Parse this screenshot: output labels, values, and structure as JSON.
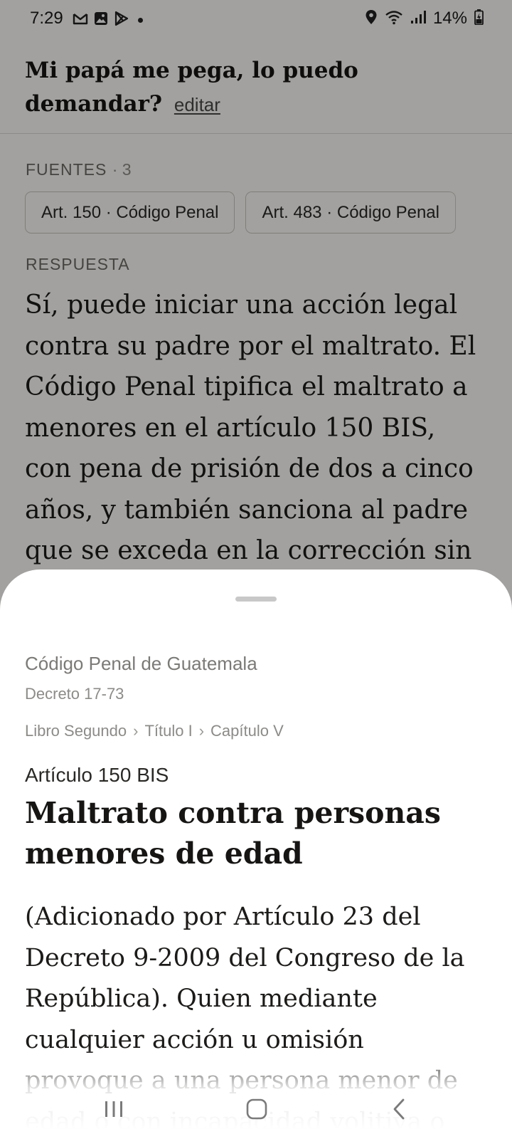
{
  "status_bar": {
    "time": "7:29",
    "battery": "14%",
    "left_icons": [
      "gmail-icon",
      "gallery-icon",
      "play-store-icon",
      "notification-dot"
    ],
    "right_icons": [
      "location-icon",
      "wifi-icon",
      "signal-icon",
      "battery-charging-icon"
    ]
  },
  "question": {
    "text": "Mi papá me pega, lo puedo demandar?",
    "edit_label": "editar"
  },
  "sources": {
    "label": "FUENTES",
    "count": "· 3",
    "chips": [
      {
        "label": "Art. 150 · Código Penal"
      },
      {
        "label": "Art. 483 · Código Penal"
      }
    ]
  },
  "answer": {
    "label": "RESPUESTA",
    "text": "Sí, puede iniciar una acción legal contra su padre por el maltrato. El Código Penal tipifica el maltrato a menores en el artículo 150 BIS, con pena de prisión de dos a cinco años, y también sanciona al padre que se exceda en la corrección sin"
  },
  "sheet": {
    "law_name": "Código Penal de Guatemala",
    "decree": "Decreto 17-73",
    "breadcrumb": [
      "Libro Segundo",
      "Título I",
      "Capítulo V"
    ],
    "breadcrumb_separator": "›",
    "article_number": "Artículo 150 BIS",
    "article_title": "Maltrato contra personas menores de edad",
    "article_body": "(Adicionado por Artículo 23 del Decreto 9-2009 del Congreso de la República). Quien mediante cualquier acción u omisión provoque a una persona menor de edad o con incapacidad volitiva o"
  },
  "nav_bar": {
    "buttons": [
      "recents-icon",
      "home-icon",
      "back-icon"
    ]
  },
  "colors": {
    "background": "#fdfcf9",
    "scrim": "rgba(0,0,0,0.36)",
    "sheet": "#ffffff",
    "text": "#1c1b19",
    "muted": "#6d6b66"
  }
}
